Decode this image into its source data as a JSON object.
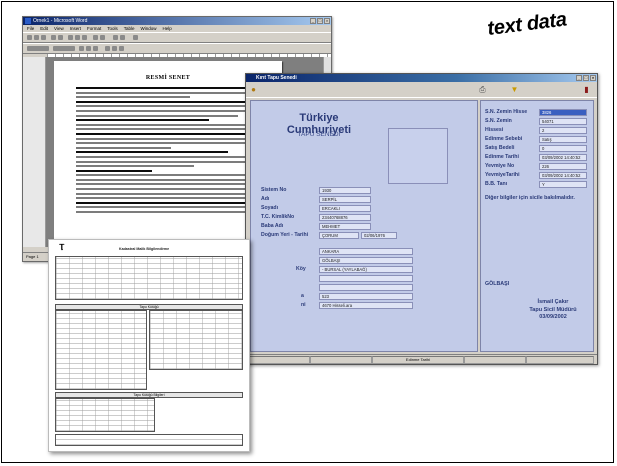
{
  "word": {
    "title": "Ornek1 - Microsoft Word",
    "menu": [
      "File",
      "Edit",
      "View",
      "Insert",
      "Format",
      "Tools",
      "Table",
      "Window",
      "Help"
    ],
    "doc_title": "RESMİ SENET",
    "status": "Page 1"
  },
  "app": {
    "title": "Kırıt Tapu Senedi",
    "country": "Türkiye Cumhuriyeti",
    "deed_label": "TAPU SENEDİ",
    "left_fields": [
      {
        "label": "Sistem No",
        "value": "1930"
      },
      {
        "label": "Adı",
        "value": "SERPİL"
      },
      {
        "label": "Soyadı",
        "value": "ERCAKLI"
      },
      {
        "label": "T.C. KimlikNo",
        "value": "23440768876"
      },
      {
        "label": "Baba Adı",
        "value": "MEHMET"
      },
      {
        "label": "Doğum Yeri - Tarihi",
        "value": "ÇORUM",
        "value2": "02/06/1976"
      }
    ],
    "lower_fields": [
      {
        "label": "",
        "value": "ANKARA"
      },
      {
        "label": "",
        "value": "GÖLBAŞI"
      },
      {
        "label": "Köy",
        "value": "- BURSAL (YAYLABAĞ)"
      },
      {
        "label": "",
        "value": ""
      },
      {
        "label": "",
        "value": ""
      },
      {
        "label": "a",
        "value": "523"
      },
      {
        "label": "ni",
        "value": "4670 Hisseli.ara"
      }
    ],
    "right_fields": [
      {
        "label": "S.N. Zemin Hisse",
        "value": "3826"
      },
      {
        "label": "S.N. Zemin",
        "value": "54071"
      },
      {
        "label": "Hissesi",
        "value": "2"
      },
      {
        "label": "Edinme Sebebi",
        "value": "Satış"
      },
      {
        "label": "Satış Bedeli",
        "value": "0"
      },
      {
        "label": "Edinme Tarihi",
        "value": "03/09/2002 14:40:52"
      },
      {
        "label": "Yevmiye No",
        "value": "226"
      },
      {
        "label": "YevmiyeTarihi",
        "value": "03/09/2002 14:40:52"
      },
      {
        "label": "B.B. Tanı",
        "value": "Y"
      }
    ],
    "note": "Diğer bilgiler için sicile bakılmalıdır.",
    "office": "GÖLBAŞI",
    "signature": [
      "İsmail Çakır",
      "Tapu Sicil Müdürü",
      "03/09/2002"
    ],
    "status_field": "Edinme Tarihi"
  },
  "banner": "text data",
  "form": {
    "heading": "Kadastral Malik Bilgilendirme",
    "section1": "Tapu Kütüğü",
    "section2": "Tapu Kütüğü Bilgileri"
  }
}
